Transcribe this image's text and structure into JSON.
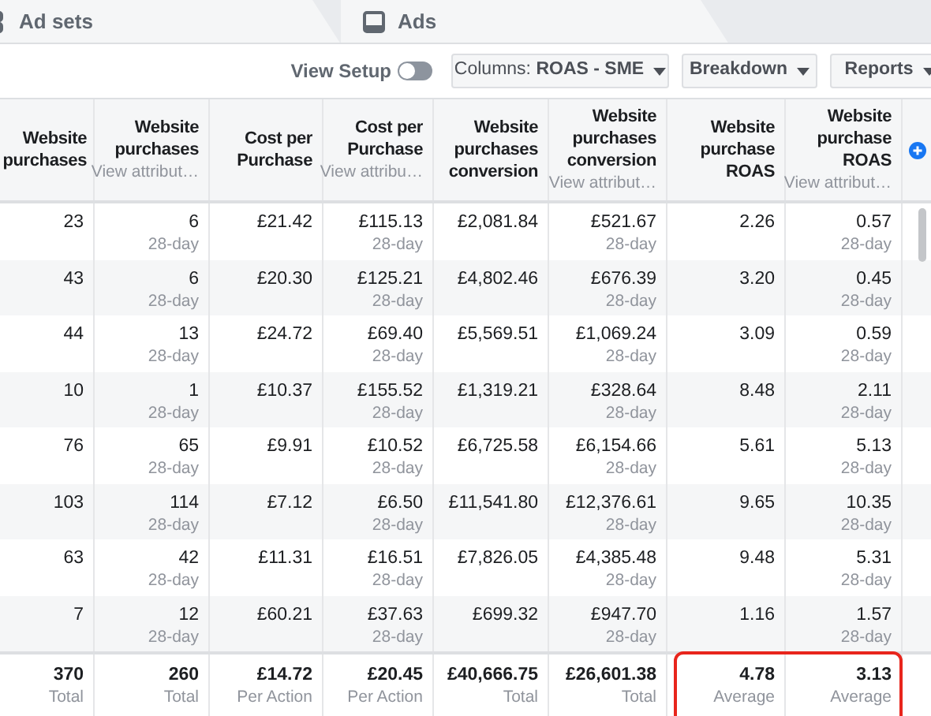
{
  "tabs": [
    {
      "label": "Ad sets"
    },
    {
      "label": "Ads"
    }
  ],
  "toolbar": {
    "view_setup": {
      "label": "View Setup",
      "on": false
    },
    "buttons": [
      "Columns: **ROAS - SME**",
      "Breakdown",
      "Reports"
    ]
  },
  "table": {
    "columns": [
      {
        "title": "Website purchases"
      },
      {
        "title": "Website purchases",
        "subtitle": "View attribut…"
      },
      {
        "title": "Cost per Purchase"
      },
      {
        "title": "Cost per Purchase",
        "subtitle": "View attribu…"
      },
      {
        "title": "Website purchases conversion"
      },
      {
        "title": "Website purchases conversion",
        "subtitle": "View attribut…"
      },
      {
        "title": "Website purchase ROAS"
      },
      {
        "title": "Website purchase ROAS",
        "subtitle": "View attribut…"
      }
    ],
    "rows": [
      {
        "cells": [
          {
            "value": "23"
          },
          {
            "value": "6",
            "note": "28-day"
          },
          {
            "value": "£21.42"
          },
          {
            "value": "£115.13",
            "note": "28-day"
          },
          {
            "value": "£2,081.84"
          },
          {
            "value": "£521.67",
            "note": "28-day"
          },
          {
            "value": "2.26"
          },
          {
            "value": "0.57",
            "note": "28-day"
          }
        ]
      },
      {
        "cells": [
          {
            "value": "43"
          },
          {
            "value": "6",
            "note": "28-day"
          },
          {
            "value": "£20.30"
          },
          {
            "value": "£125.21",
            "note": "28-day"
          },
          {
            "value": "£4,802.46"
          },
          {
            "value": "£676.39",
            "note": "28-day"
          },
          {
            "value": "3.20"
          },
          {
            "value": "0.45",
            "note": "28-day"
          }
        ]
      },
      {
        "cells": [
          {
            "value": "44"
          },
          {
            "value": "13",
            "note": "28-day"
          },
          {
            "value": "£24.72"
          },
          {
            "value": "£69.40",
            "note": "28-day"
          },
          {
            "value": "£5,569.51"
          },
          {
            "value": "£1,069.24",
            "note": "28-day"
          },
          {
            "value": "3.09"
          },
          {
            "value": "0.59",
            "note": "28-day"
          }
        ]
      },
      {
        "cells": [
          {
            "value": "10"
          },
          {
            "value": "1",
            "note": "28-day"
          },
          {
            "value": "£10.37"
          },
          {
            "value": "£155.52",
            "note": "28-day"
          },
          {
            "value": "£1,319.21"
          },
          {
            "value": "£328.64",
            "note": "28-day"
          },
          {
            "value": "8.48"
          },
          {
            "value": "2.11",
            "note": "28-day"
          }
        ]
      },
      {
        "cells": [
          {
            "value": "76"
          },
          {
            "value": "65",
            "note": "28-day"
          },
          {
            "value": "£9.91"
          },
          {
            "value": "£10.52",
            "note": "28-day"
          },
          {
            "value": "£6,725.58"
          },
          {
            "value": "£6,154.66",
            "note": "28-day"
          },
          {
            "value": "5.61"
          },
          {
            "value": "5.13",
            "note": "28-day"
          }
        ]
      },
      {
        "cells": [
          {
            "value": "103"
          },
          {
            "value": "114",
            "note": "28-day"
          },
          {
            "value": "£7.12"
          },
          {
            "value": "£6.50",
            "note": "28-day"
          },
          {
            "value": "£11,541.80"
          },
          {
            "value": "£12,376.61",
            "note": "28-day"
          },
          {
            "value": "9.65"
          },
          {
            "value": "10.35",
            "note": "28-day"
          }
        ]
      },
      {
        "cells": [
          {
            "value": "63"
          },
          {
            "value": "42",
            "note": "28-day"
          },
          {
            "value": "£11.31"
          },
          {
            "value": "£16.51",
            "note": "28-day"
          },
          {
            "value": "£7,826.05"
          },
          {
            "value": "£4,385.48",
            "note": "28-day"
          },
          {
            "value": "9.48"
          },
          {
            "value": "5.31",
            "note": "28-day"
          }
        ]
      },
      {
        "cells": [
          {
            "value": "7"
          },
          {
            "value": "12",
            "note": "28-day"
          },
          {
            "value": "£60.21"
          },
          {
            "value": "£37.63",
            "note": "28-day"
          },
          {
            "value": "£699.32"
          },
          {
            "value": "£947.70",
            "note": "28-day"
          },
          {
            "value": "1.16"
          },
          {
            "value": "1.57",
            "note": "28-day"
          }
        ]
      }
    ],
    "footer": [
      {
        "value": "370",
        "note": "Total",
        "highlighted": false
      },
      {
        "value": "260",
        "note": "Total",
        "highlighted": false
      },
      {
        "value": "£14.72",
        "note": "Per Action",
        "highlighted": false
      },
      {
        "value": "£20.45",
        "note": "Per Action",
        "highlighted": false
      },
      {
        "value": "£40,666.75",
        "note": "Total",
        "highlighted": false
      },
      {
        "value": "£26,601.38",
        "note": "Total",
        "highlighted": false
      },
      {
        "value": "4.78",
        "note": "Average",
        "highlighted": true
      },
      {
        "value": "3.13",
        "note": "Average",
        "highlighted": true
      }
    ]
  }
}
